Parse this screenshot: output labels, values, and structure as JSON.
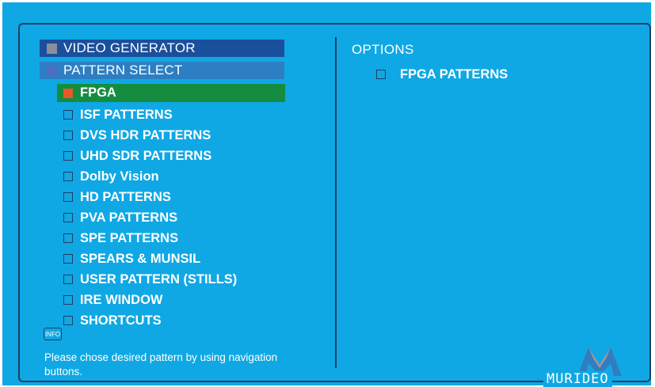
{
  "header": {
    "title": "VIDEO GENERATOR",
    "subtitle": "PATTERN SELECT"
  },
  "menu": {
    "items": [
      {
        "label": "FPGA",
        "selected": true
      },
      {
        "label": "ISF PATTERNS",
        "selected": false
      },
      {
        "label": "DVS HDR PATTERNS",
        "selected": false
      },
      {
        "label": "UHD SDR PATTERNS",
        "selected": false
      },
      {
        "label": "Dolby Vision",
        "selected": false
      },
      {
        "label": "HD PATTERNS",
        "selected": false
      },
      {
        "label": "PVA PATTERNS",
        "selected": false
      },
      {
        "label": "SPE PATTERNS",
        "selected": false
      },
      {
        "label": "SPEARS & MUNSIL",
        "selected": false
      },
      {
        "label": "USER PATTERN (STILLS)",
        "selected": false
      },
      {
        "label": "IRE WINDOW",
        "selected": false
      },
      {
        "label": "SHORTCUTS",
        "selected": false
      }
    ]
  },
  "info": {
    "badge": "INFO",
    "message": "Please chose desired pattern by using navigation buttons."
  },
  "options": {
    "title": "OPTIONS",
    "items": [
      {
        "label": "FPGA PATTERNS"
      }
    ]
  },
  "brand": {
    "name": "MURIDEO"
  },
  "colors": {
    "background": "#0fa8e4",
    "frame": "#1f3f66",
    "header_dark": "#1a4f9c",
    "header_light": "#2c7fc2",
    "selected_row": "#168c40",
    "selected_marker": "#e8592a"
  },
  "icons": {
    "unchecked": "checkbox-empty-icon",
    "selected": "orange-square-icon"
  }
}
